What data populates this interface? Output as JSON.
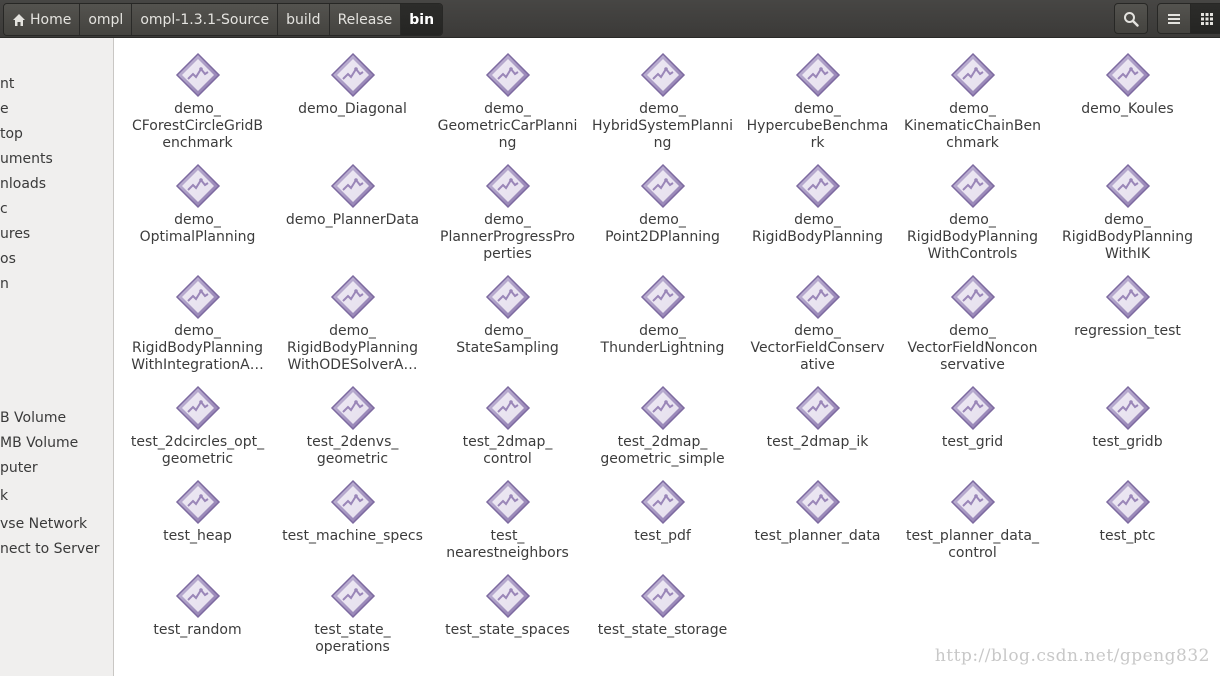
{
  "header": {
    "breadcrumbs": [
      "Home",
      "ompl",
      "ompl-1.3.1-Source",
      "build",
      "Release",
      "bin"
    ]
  },
  "sidebar": {
    "items": [
      "nt",
      "e",
      "top",
      "uments",
      "nloads",
      "c",
      "ures",
      "os",
      "n",
      "B Volume",
      "MB Volume",
      "puter",
      "k",
      "vse Network",
      "nect to Server"
    ]
  },
  "files": [
    "demo_\nCForestCircleGridB\nenchmark",
    "demo_Diagonal",
    "demo_\nGeometricCarPlanni\nng",
    "demo_\nHybridSystemPlanni\nng",
    "demo_\nHypercubeBenchma\nrk",
    "demo_\nKinematicChainBen\nchmark",
    "demo_Koules",
    "demo_\nOptimalPlanning",
    "demo_PlannerData",
    "demo_\nPlannerProgressPro\nperties",
    "demo_\nPoint2DPlanning",
    "demo_\nRigidBodyPlanning",
    "demo_\nRigidBodyPlanning\nWithControls",
    "demo_\nRigidBodyPlanning\nWithIK",
    "demo_\nRigidBodyPlanning\nWithIntegrationA…",
    "demo_\nRigidBodyPlanning\nWithODESolverA…",
    "demo_\nStateSampling",
    "demo_\nThunderLightning",
    "demo_\nVectorFieldConserv\native",
    "demo_\nVectorFieldNoncon\nservative",
    "regression_test",
    "test_2dcircles_opt_\ngeometric",
    "test_2denvs_\ngeometric",
    "test_2dmap_\ncontrol",
    "test_2dmap_\ngeometric_simple",
    "test_2dmap_ik",
    "test_grid",
    "test_gridb",
    "test_heap",
    "test_machine_specs",
    "test_\nnearestneighbors",
    "test_pdf",
    "test_planner_data",
    "test_planner_data_\ncontrol",
    "test_ptc",
    "test_random",
    "test_state_\noperations",
    "test_state_spaces",
    "test_state_storage"
  ],
  "watermark": "http://blog.csdn.net/gpeng832",
  "icons": {
    "home": "home-icon",
    "search": "search-icon",
    "list_view": "list-view-icon",
    "grid_view": "grid-view-icon",
    "file": "executable-file-icon"
  },
  "colors": {
    "header_bg": "#41403d",
    "sidebar_bg": "#f0efee",
    "icon_purple": "#9a86b8"
  }
}
